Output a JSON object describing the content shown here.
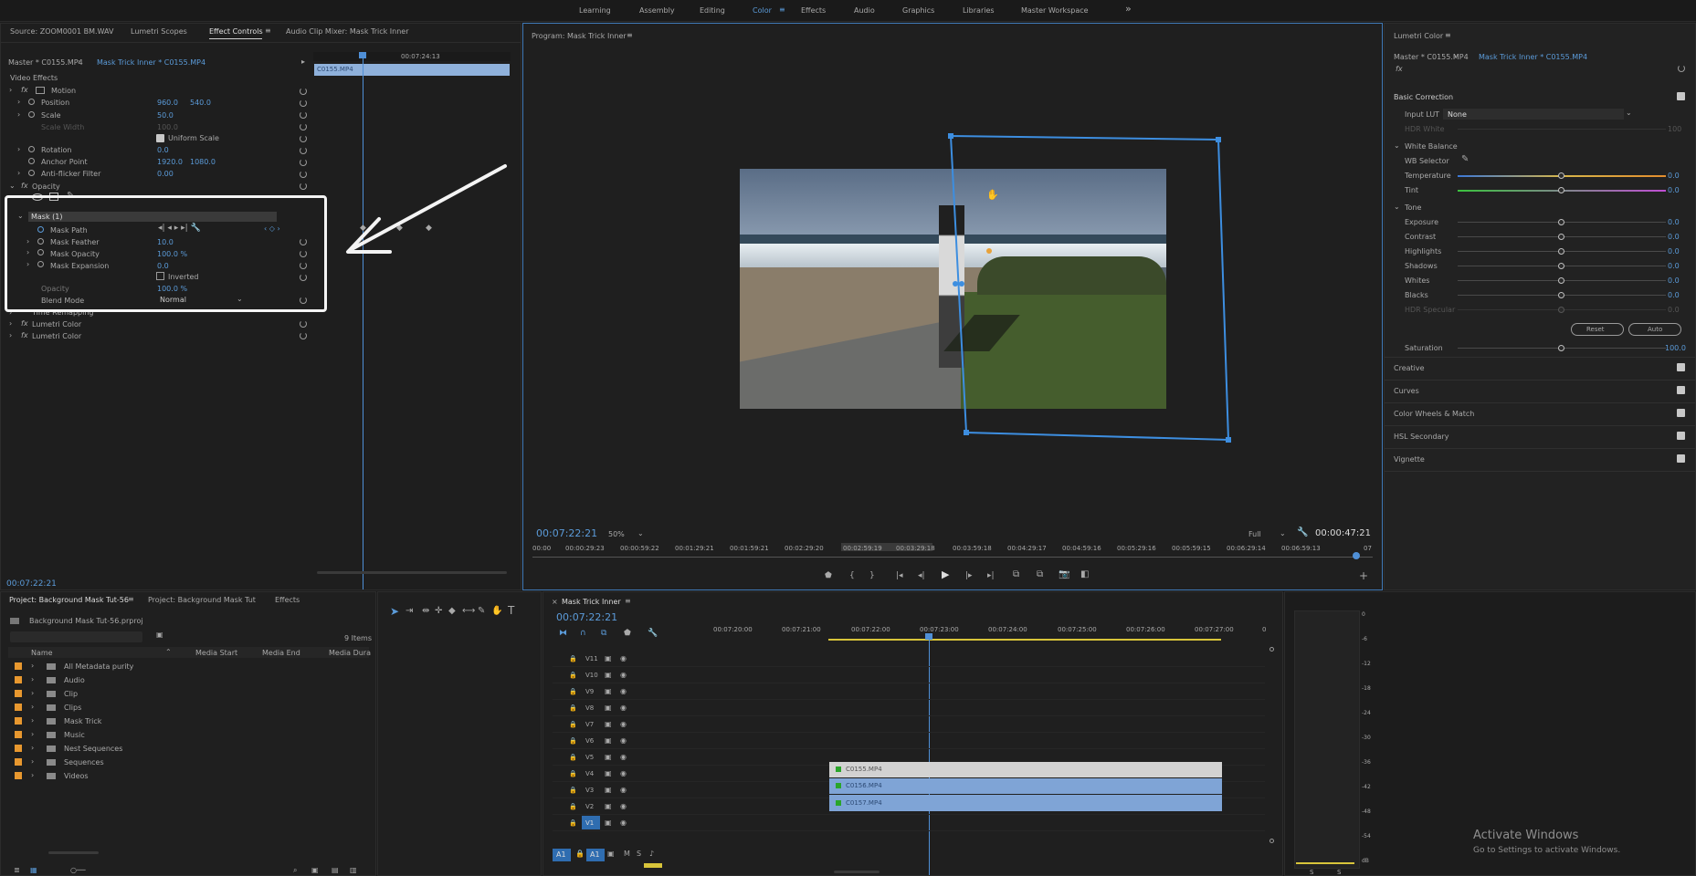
{
  "workspaces": [
    "Learning",
    "Assembly",
    "Editing",
    "Color",
    "Effects",
    "Audio",
    "Graphics",
    "Libraries",
    "Master Workspace"
  ],
  "workspace_active": "Color",
  "more_glyph": "»",
  "source_tabs": {
    "source": "Source: ZOOM0001 BM.WAV",
    "scopes": "Lumetri Scopes",
    "effect_controls": "Effect Controls",
    "mixer": "Audio Clip Mixer: Mask Trick Inner"
  },
  "ec": {
    "master": "Master * C0155.MP4",
    "clip": "Mask Trick Inner * C0155.MP4",
    "ruler_time": "00:07:24:13",
    "clip_bar": "C0155.MP4",
    "video_effects": "Video Effects",
    "motion": "Motion",
    "position_label": "Position",
    "position_x": "960.0",
    "position_y": "540.0",
    "scale_label": "Scale",
    "scale_val": "50.0",
    "scale_width_label": "Scale Width",
    "scale_width_val": "100.0",
    "uniform_scale": "Uniform Scale",
    "rotation_label": "Rotation",
    "rotation_val": "0.0",
    "anchor_label": "Anchor Point",
    "anchor_x": "1920.0",
    "anchor_y": "1080.0",
    "antiflicker_label": "Anti-flicker Filter",
    "antiflicker_val": "0.00",
    "opacity_group": "Opacity",
    "mask_name": "Mask (1)",
    "mask_path": "Mask Path",
    "mask_feather": "Mask Feather",
    "mask_feather_val": "10.0",
    "mask_opacity": "Mask Opacity",
    "mask_opacity_val": "100.0 %",
    "mask_expansion": "Mask Expansion",
    "mask_expansion_val": "0.0",
    "inverted": "Inverted",
    "opacity_label": "Opacity",
    "opacity_val": "100.0 %",
    "blend_label": "Blend Mode",
    "blend_val": "Normal",
    "time_remap": "Time Remapping",
    "lumetri1": "Lumetri Color",
    "lumetri2": "Lumetri Color",
    "timecode": "00:07:22:21"
  },
  "program": {
    "title": "Program: Mask Trick Inner",
    "timecode": "00:07:22:21",
    "zoom": "50%",
    "quality": "Full",
    "duration": "00:00:47:21",
    "ruler": [
      "00:00",
      "00:00:29:23",
      "00:00:59:22",
      "00:01:29:21",
      "00:01:59:21",
      "00:02:29:20",
      "00:02:59:19",
      "00:03:29:18",
      "00:03:59:18",
      "00:04:29:17",
      "00:04:59:16",
      "00:05:29:16",
      "00:05:59:15",
      "00:06:29:14",
      "00:06:59:13",
      "07"
    ]
  },
  "lumetri": {
    "title": "Lumetri Color",
    "master": "Master * C0155.MP4",
    "clip": "Mask Trick Inner * C0155.MP4",
    "fx": "fx",
    "basic": "Basic Correction",
    "input_lut_label": "Input LUT",
    "input_lut_val": "None",
    "hdr_white": "HDR White",
    "hdr_white_val": "100",
    "white_balance": "White Balance",
    "wb_selector": "WB Selector",
    "temperature": "Temperature",
    "temperature_val": "0.0",
    "tint": "Tint",
    "tint_val": "0.0",
    "tone": "Tone",
    "exposure": "Exposure",
    "exposure_val": "0.0",
    "contrast": "Contrast",
    "contrast_val": "0.0",
    "highlights": "Highlights",
    "highlights_val": "0.0",
    "shadows": "Shadows",
    "shadows_val": "0.0",
    "whites": "Whites",
    "whites_val": "0.0",
    "blacks": "Blacks",
    "blacks_val": "0.0",
    "hdr_specular": "HDR Specular",
    "hdr_specular_val": "0.0",
    "reset": "Reset",
    "auto": "Auto",
    "saturation": "Saturation",
    "saturation_val": "100.0",
    "sections": [
      "Creative",
      "Curves",
      "Color Wheels & Match",
      "HSL Secondary",
      "Vignette"
    ]
  },
  "project": {
    "tab1": "Project: Background Mask Tut-56",
    "tab2": "Project: Background Mask Tut",
    "tab3": "Effects",
    "file": "Background Mask Tut-56.prproj",
    "items_count": "9 Items",
    "columns": [
      "Name",
      "Media Start",
      "Media End",
      "Media Dura"
    ],
    "bins": [
      "All Metadata purity",
      "Audio",
      "Clip",
      "Clips",
      "Mask Trick",
      "Music",
      "Nest Sequences",
      "Sequences",
      "Videos"
    ],
    "bin_color": "#e8982f"
  },
  "timeline": {
    "title": "Mask Trick Inner",
    "timecode": "00:07:22:21",
    "ruler": [
      "00:07:20:00",
      "00:07:21:00",
      "00:07:22:00",
      "00:07:23:00",
      "00:07:24:00",
      "00:07:25:00",
      "00:07:26:00",
      "00:07:27:00",
      "0"
    ],
    "tracks": [
      "V11",
      "V10",
      "V9",
      "V8",
      "V7",
      "V6",
      "V5",
      "V4",
      "V3",
      "V2",
      "V1"
    ],
    "audio_tracks": [
      "A1",
      "A1"
    ],
    "clips": [
      "C0155.MP4",
      "C0156.MP4",
      "C0157.MP4"
    ]
  },
  "meter": [
    "0",
    "-6",
    "-12",
    "-18",
    "-24",
    "-30",
    "-36",
    "-42",
    "-48",
    "-54",
    "dB"
  ],
  "watermark": {
    "line1": "Activate Windows",
    "line2": "Go to Settings to activate Windows."
  }
}
